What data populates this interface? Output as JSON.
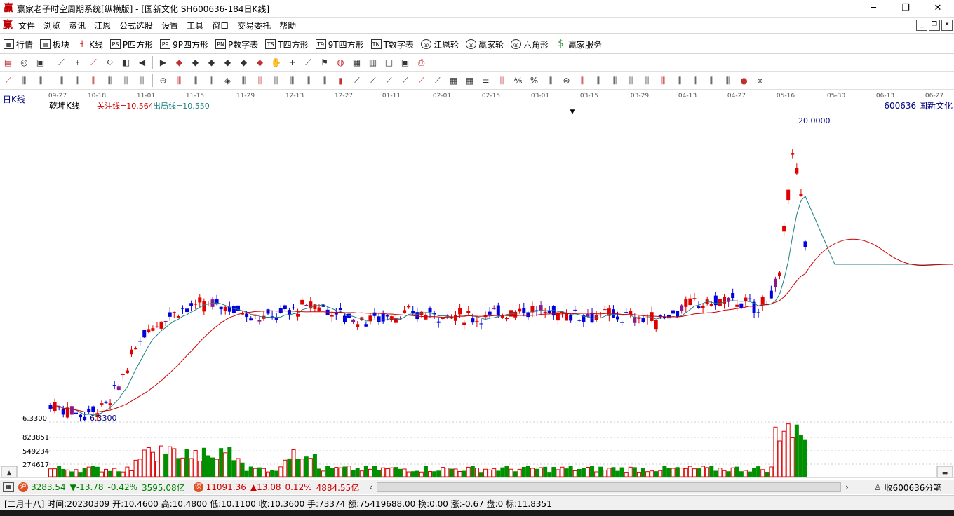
{
  "window": {
    "title": "赢家老子时空周期系统[纵横版] - [国新文化  SH600636-184日K线]",
    "minimize": "─",
    "maximize": "❐",
    "close": "✕"
  },
  "menu": {
    "items": [
      "文件",
      "浏览",
      "资讯",
      "江恩",
      "公式选股",
      "设置",
      "工具",
      "窗口",
      "交易委托",
      "帮助"
    ]
  },
  "toolbar": {
    "items": [
      "行情",
      "板块",
      "K线",
      "P四方形",
      "9P四方形",
      "P数字表",
      "T四方形",
      "9T四方形",
      "T数字表",
      "江恩轮",
      "赢家轮",
      "六角形",
      "赢家服务"
    ]
  },
  "chart": {
    "period_label": "日K线",
    "indicator_name": "乾坤K线",
    "guanzhu": "关注线=10.564",
    "chuju": "出局线=10.550",
    "stock": "600636  国新文化",
    "high_label": "20.0000",
    "low_label": "6.3300",
    "low_axis": "6.3300",
    "date_ticks": [
      "09-27",
      "10-18",
      "11-01",
      "11-15",
      "11-29",
      "12-13",
      "12-27",
      "01-11",
      "02-01",
      "02-15",
      "03-01",
      "03-15",
      "03-29",
      "04-13",
      "04-27",
      "05-16",
      "05-30",
      "06-13",
      "06-27"
    ],
    "vol_ticks": [
      "823851",
      "549234",
      "274617"
    ],
    "dropdown_arrow": "▼"
  },
  "chart_data": {
    "type": "candlestick",
    "price_range": [
      6.33,
      20.0
    ],
    "colors": {
      "up": "#e00000",
      "down": "#0000e0",
      "neutral": "#8a1a8a",
      "vol_up": "#e00000",
      "vol_down": "#009000",
      "ma1": "#208080",
      "ma2": "#d00000"
    }
  },
  "status": {
    "sh_index": "3283.54",
    "sh_change": "▼-13.78",
    "sh_pct": "-0.42%",
    "sh_amount": "3595.08亿",
    "sz_index": "11091.36",
    "sz_change": "▲13.08",
    "sz_pct": "0.12%",
    "sz_amount": "4884.55亿",
    "right_text": "收600636分笔"
  },
  "info": {
    "text": "[二月十八] 时间:20230309 开:10.4600 高:10.4800 低:10.1100 收:10.3600 手:73374 额:75419688.00 换:0.00 涨:-0.67 盘:0 标:11.8351"
  }
}
